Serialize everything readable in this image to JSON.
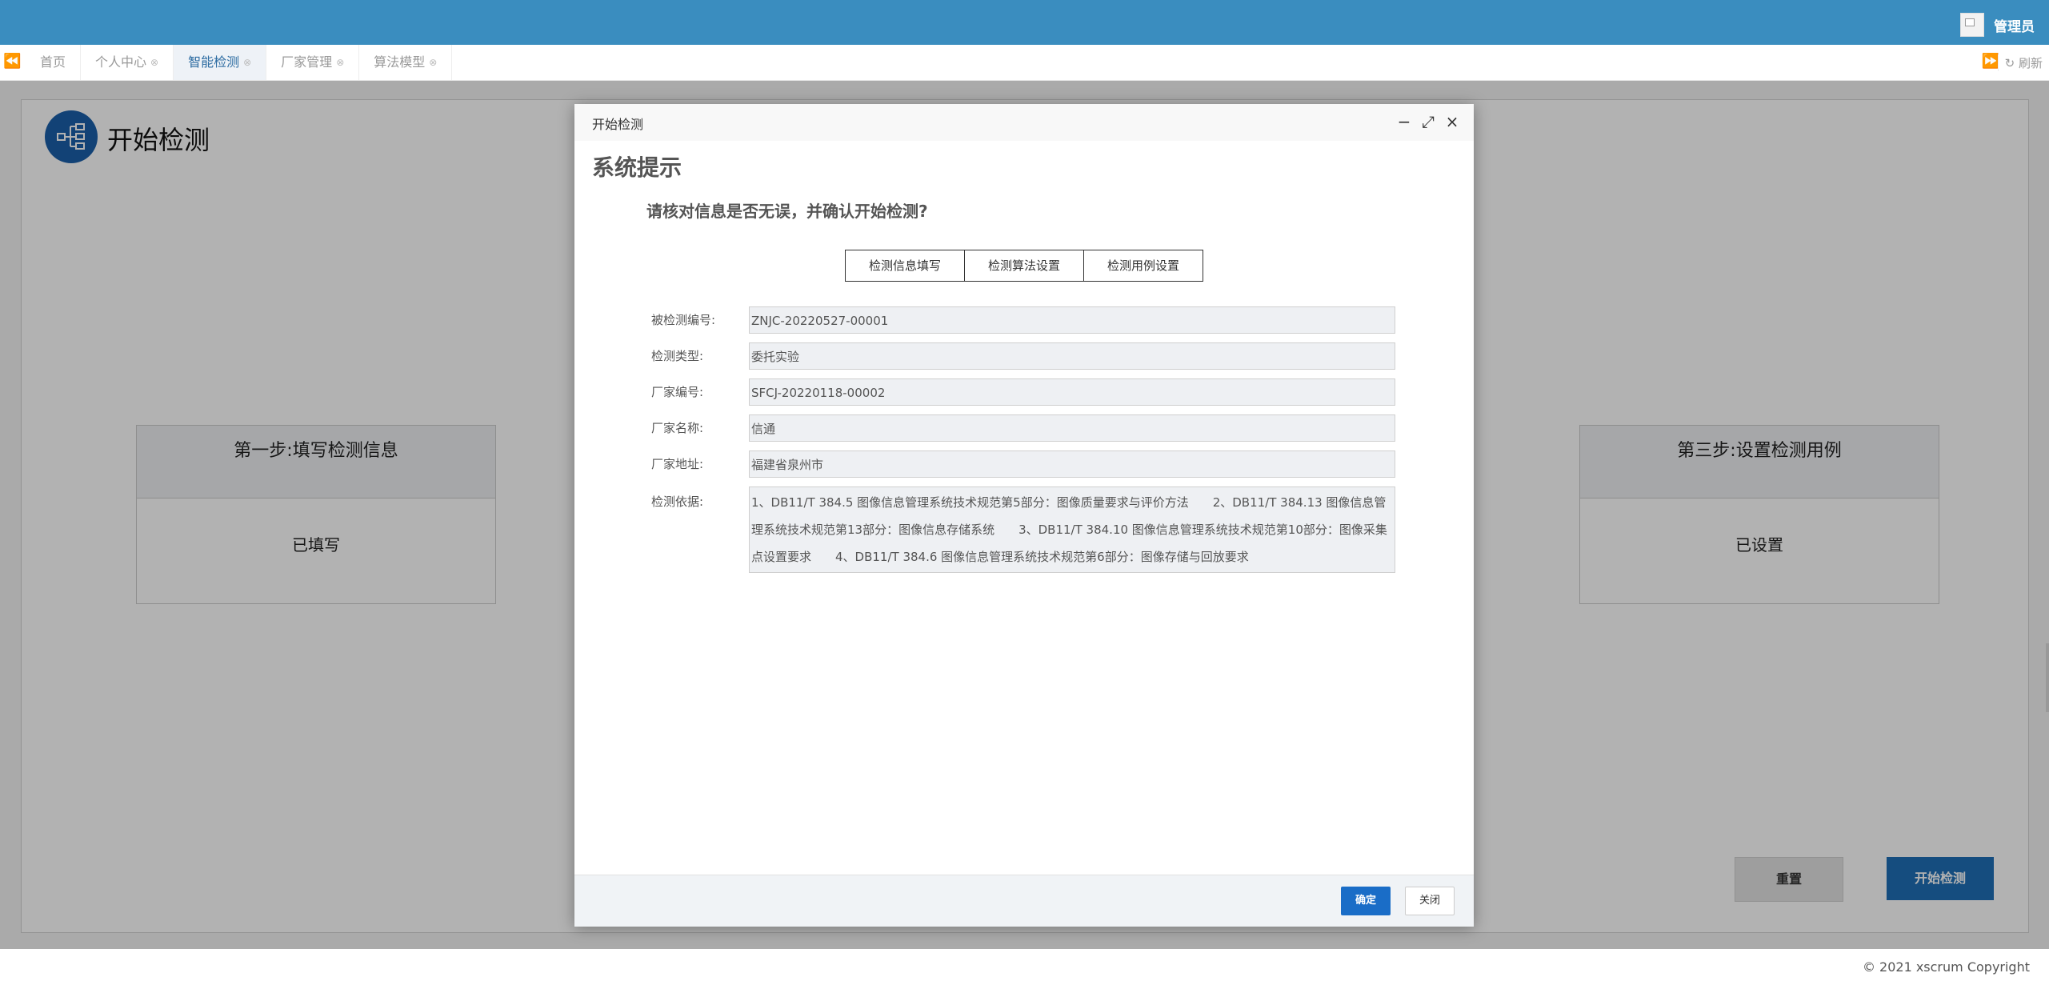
{
  "header": {
    "user_label": "管理员"
  },
  "tabs": {
    "items": [
      {
        "label": "首页",
        "closable": false,
        "active": false
      },
      {
        "label": "个人中心",
        "closable": true,
        "active": false
      },
      {
        "label": "智能检测",
        "closable": true,
        "active": true
      },
      {
        "label": "厂家管理",
        "closable": true,
        "active": false
      },
      {
        "label": "算法模型",
        "closable": true,
        "active": false
      }
    ],
    "refresh_label": "刷新"
  },
  "page": {
    "title": "开始检测",
    "step1": {
      "title": "第一步:填写检测信息",
      "status": "已填写"
    },
    "step3": {
      "title": "第三步:设置检测用例",
      "status": "已设置"
    },
    "reset_button": "重置",
    "start_button": "开始检测"
  },
  "dialog": {
    "title": "开始检测",
    "heading": "系统提示",
    "question": "请核对信息是否无误，并确认开始检测?",
    "step_tabs": [
      "检测信息填写",
      "检测算法设置",
      "检测用例设置"
    ],
    "fields": [
      {
        "label": "被检测编号:",
        "value": "ZNJC-20220527-00001"
      },
      {
        "label": "检测类型:",
        "value": "委托实验"
      },
      {
        "label": "厂家编号:",
        "value": "SFCJ-20220118-00002"
      },
      {
        "label": "厂家名称:",
        "value": "信通"
      },
      {
        "label": "厂家地址:",
        "value": "福建省泉州市"
      },
      {
        "label": "检测依据:",
        "value": "1、DB11/T 384.5 图像信息管理系统技术规范第5部分：图像质量要求与评价方法　　2、DB11/T 384.13 图像信息管理系统技术规范第13部分：图像信息存储系统　　3、DB11/T 384.10 图像信息管理系统技术规范第10部分：图像采集点设置要求　　4、DB11/T 384.6 图像信息管理系统技术规范第6部分：图像存储与回放要求"
      }
    ],
    "ok_button": "确定",
    "close_button": "关闭"
  },
  "footer": {
    "copyright": "© 2021 xscrum Copyright"
  },
  "colors": {
    "header": "#3a8dbf",
    "primary_button": "#1f6fb6",
    "icon_bg": "#1a5fa9"
  }
}
